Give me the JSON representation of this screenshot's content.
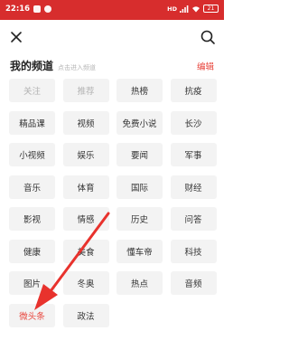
{
  "status_bar": {
    "time": "22:16",
    "network": "HD",
    "battery": "21"
  },
  "toolbar": {
    "close_icon": "close-icon",
    "search_icon": "search-icon"
  },
  "section": {
    "title": "我的频道",
    "hint": "点击进入频道",
    "edit_label": "编辑"
  },
  "channels": [
    {
      "label": "关注",
      "state": "fixed"
    },
    {
      "label": "推荐",
      "state": "fixed"
    },
    {
      "label": "热榜",
      "state": "normal"
    },
    {
      "label": "抗疫",
      "state": "normal"
    },
    {
      "label": "精品课",
      "state": "normal"
    },
    {
      "label": "视频",
      "state": "normal"
    },
    {
      "label": "免费小说",
      "state": "normal"
    },
    {
      "label": "长沙",
      "state": "normal"
    },
    {
      "label": "小视频",
      "state": "normal"
    },
    {
      "label": "娱乐",
      "state": "normal"
    },
    {
      "label": "要闻",
      "state": "normal"
    },
    {
      "label": "军事",
      "state": "normal"
    },
    {
      "label": "音乐",
      "state": "normal"
    },
    {
      "label": "体育",
      "state": "normal"
    },
    {
      "label": "国际",
      "state": "normal"
    },
    {
      "label": "财经",
      "state": "normal"
    },
    {
      "label": "影视",
      "state": "normal"
    },
    {
      "label": "情感",
      "state": "normal"
    },
    {
      "label": "历史",
      "state": "normal"
    },
    {
      "label": "问答",
      "state": "normal"
    },
    {
      "label": "健康",
      "state": "normal"
    },
    {
      "label": "美食",
      "state": "normal"
    },
    {
      "label": "懂车帝",
      "state": "normal"
    },
    {
      "label": "科技",
      "state": "normal"
    },
    {
      "label": "图片",
      "state": "normal"
    },
    {
      "label": "冬奥",
      "state": "normal"
    },
    {
      "label": "热点",
      "state": "normal"
    },
    {
      "label": "音频",
      "state": "normal"
    },
    {
      "label": "微头条",
      "state": "active"
    },
    {
      "label": "政法",
      "state": "normal"
    }
  ],
  "colors": {
    "status_bar": "#d72d2d",
    "accent": "#e8453c",
    "chip_background": "#f3f3f3",
    "annotation_arrow": "#e8322d"
  }
}
